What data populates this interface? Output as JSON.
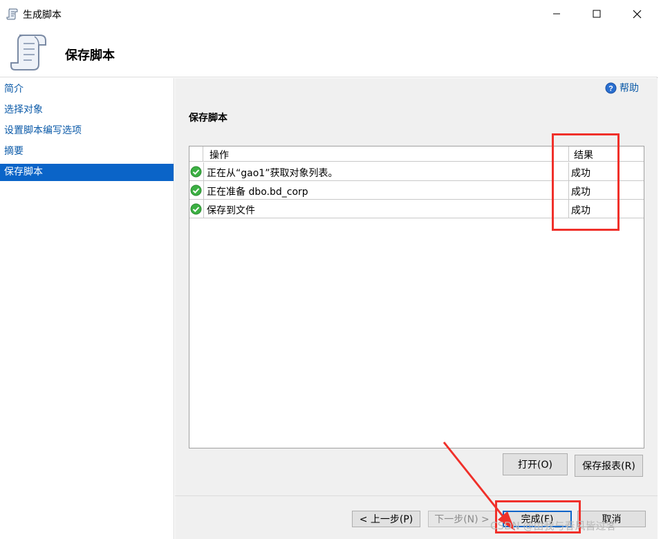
{
  "window": {
    "title": "生成脚本"
  },
  "banner": {
    "heading": "保存脚本"
  },
  "sidebar": {
    "items": [
      {
        "label": "简介",
        "active": false
      },
      {
        "label": "选择对象",
        "active": false
      },
      {
        "label": "设置脚本编写选项",
        "active": false
      },
      {
        "label": "摘要",
        "active": false
      },
      {
        "label": "保存脚本",
        "active": true
      }
    ]
  },
  "main": {
    "help_label": "帮助",
    "section_title": "保存脚本",
    "grid": {
      "columns": [
        "操作",
        "结果"
      ],
      "rows": [
        {
          "operation": "正在从“gao1”获取对象列表。",
          "result": "成功",
          "status_icon": "success-check-icon"
        },
        {
          "operation": "正在准备 dbo.bd_corp",
          "result": "成功",
          "status_icon": "success-check-icon"
        },
        {
          "operation": "保存到文件",
          "result": "成功",
          "status_icon": "success-check-icon"
        }
      ]
    },
    "open_button": "打开(O)",
    "save_report_button": "保存报表(R)"
  },
  "footer": {
    "prev_button": "< 上一步(P)",
    "next_button": "下一步(N) >",
    "finish_button": "完成(F)",
    "cancel_button": "取消"
  },
  "watermark": "CSDN @由我与春风皆过客",
  "colors": {
    "accent": "#0a64c8",
    "link": "#0b5aa8",
    "annotation": "#f0302a",
    "success": "#3cb043"
  }
}
